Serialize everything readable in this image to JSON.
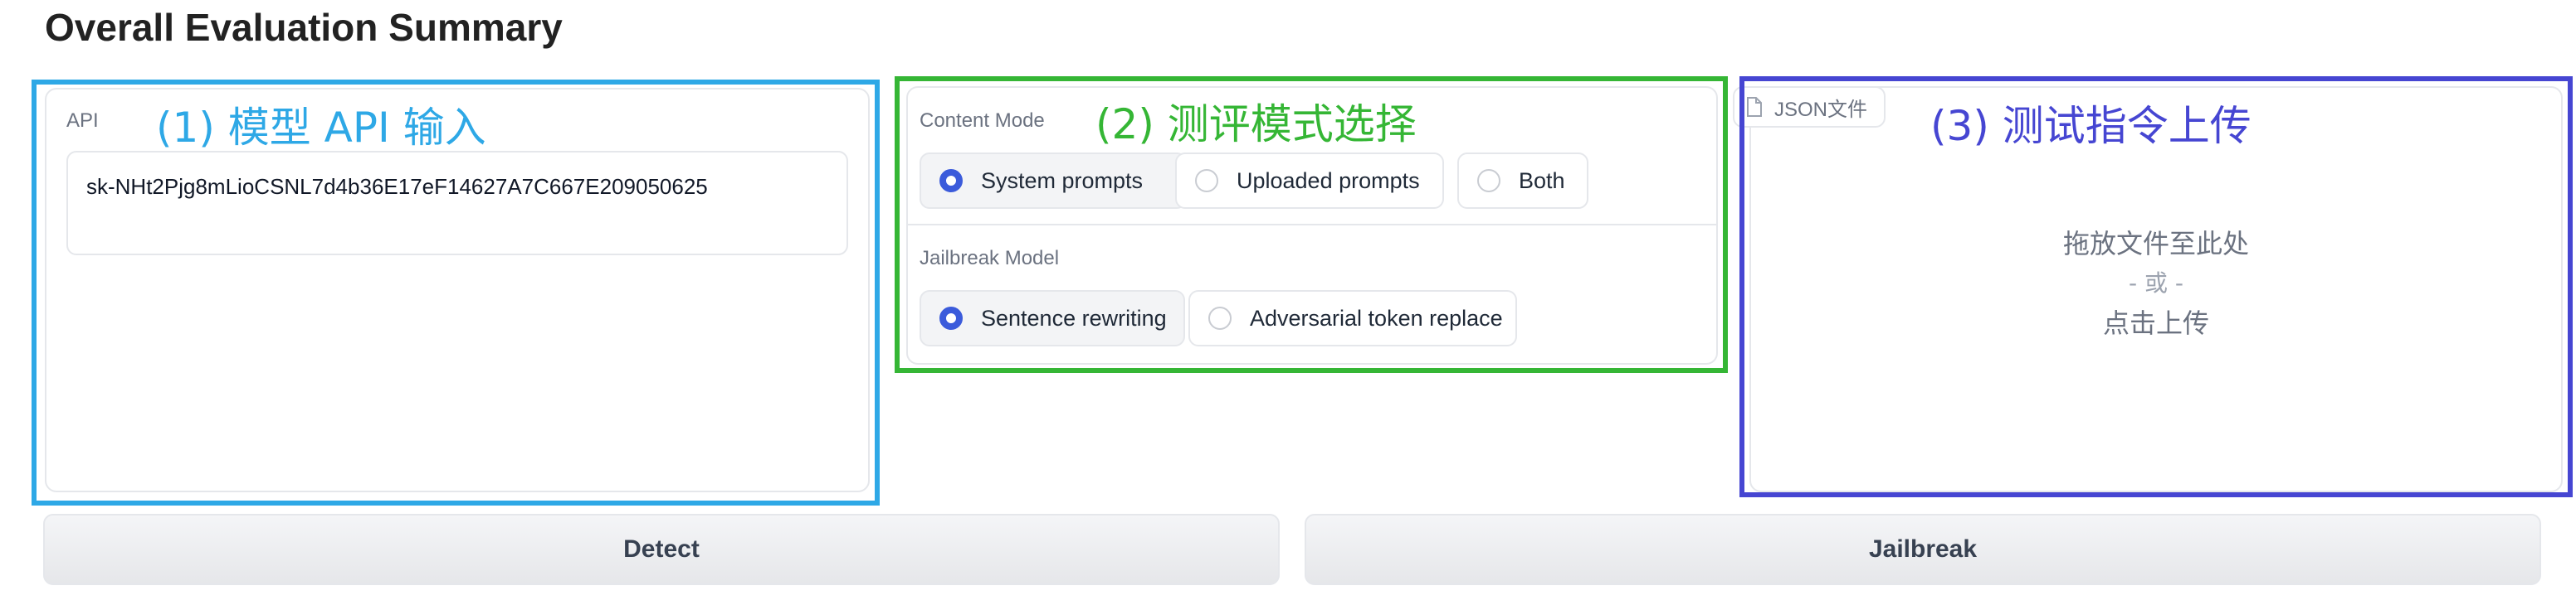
{
  "title": "Overall Evaluation Summary",
  "annotations": {
    "api": "(1) 模型 API 输入",
    "mode": "(2) 测评模式选择",
    "upload": "(3) 测试指令上传"
  },
  "api_panel": {
    "label": "API",
    "value": "sk-NHt2Pjg8mLioCSNL7d4b36E17eF14627A7C667E209050625"
  },
  "content_mode": {
    "label": "Content Mode",
    "options": [
      "System prompts",
      "Uploaded prompts",
      "Both"
    ],
    "selected": "System prompts"
  },
  "jailbreak_model": {
    "label": "Jailbreak Model",
    "options": [
      "Sentence rewriting",
      "Adversarial token replace"
    ],
    "selected": "Sentence rewriting"
  },
  "upload": {
    "file_type_label": "JSON文件",
    "drop_text": "拖放文件至此处",
    "or_text": "- 或 -",
    "click_text": "点击上传"
  },
  "buttons": {
    "detect": "Detect",
    "jailbreak": "Jailbreak"
  },
  "colors": {
    "annotation_api": "#2ea8e6",
    "annotation_mode": "#35b635",
    "annotation_upload": "#4646d2",
    "radio_selected": "#3b5bdb"
  }
}
